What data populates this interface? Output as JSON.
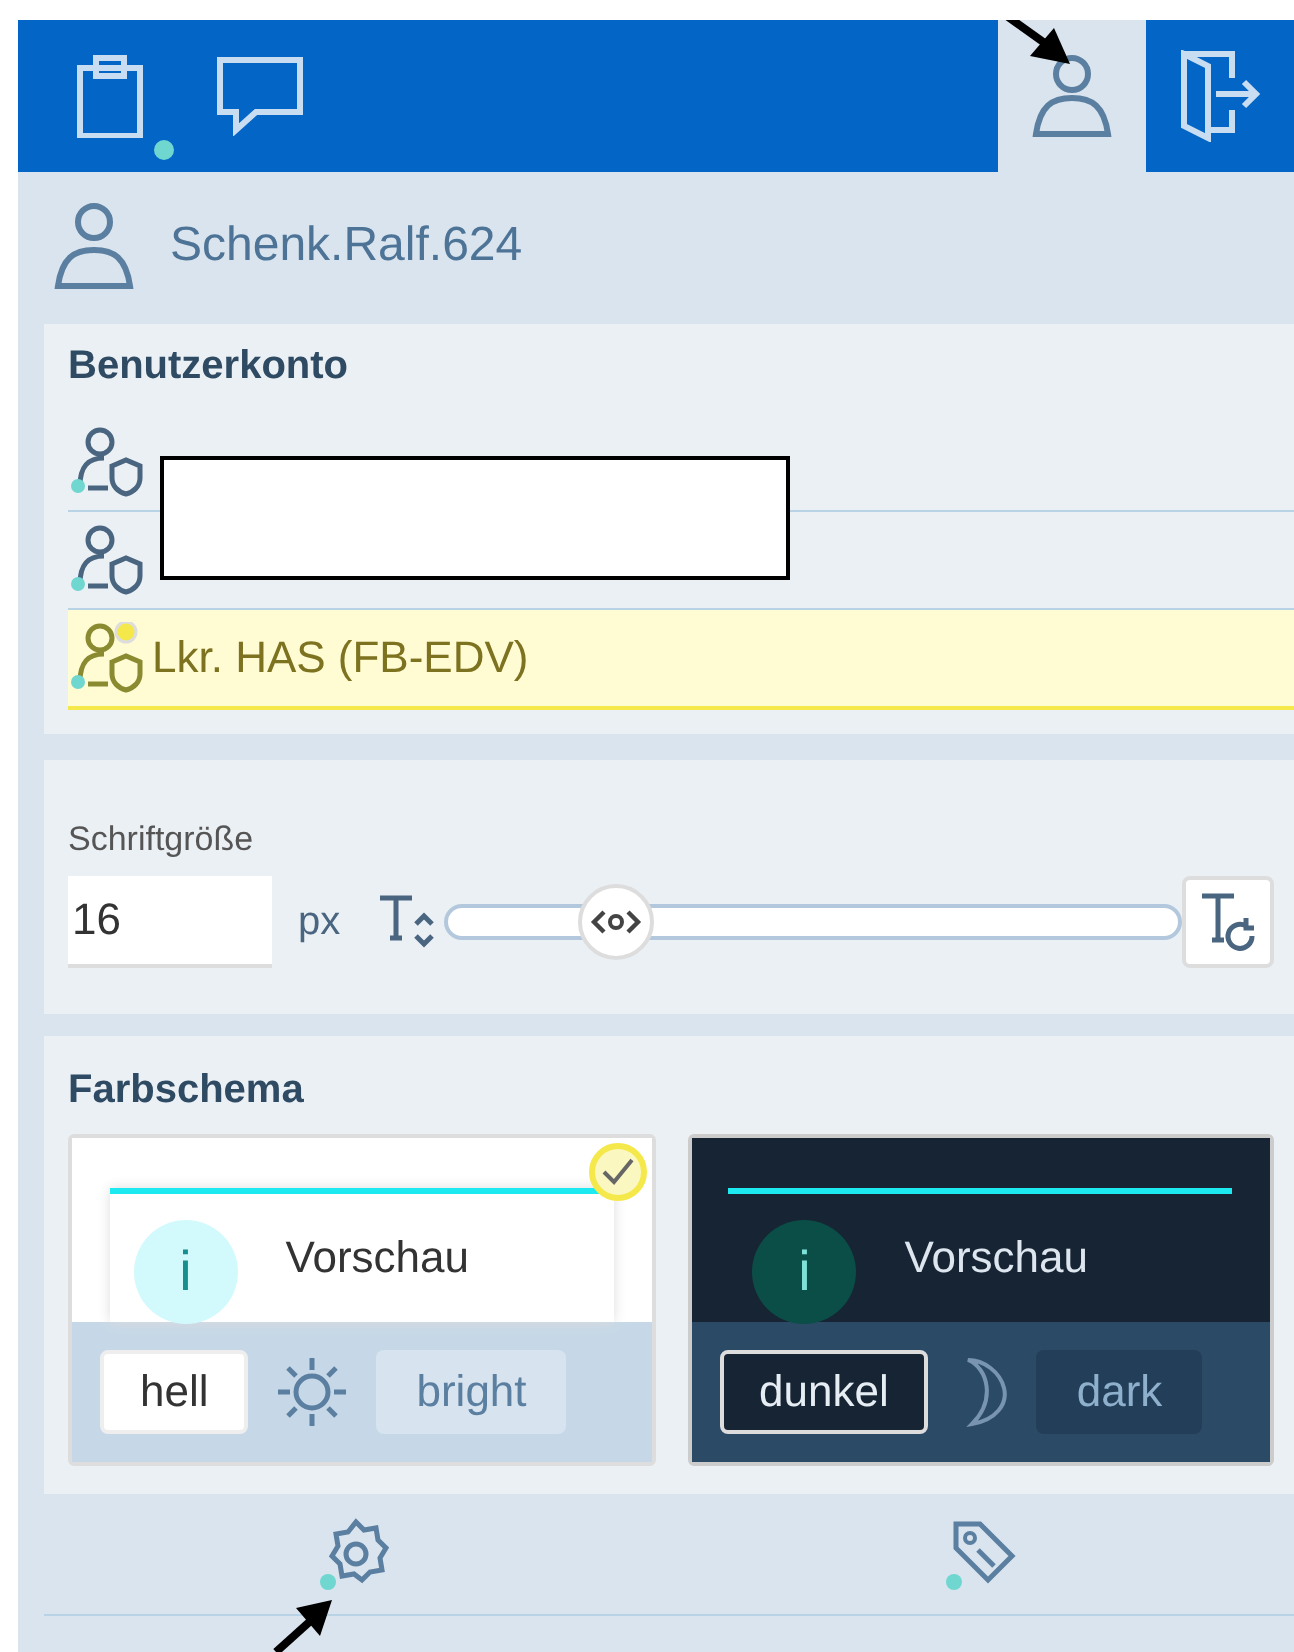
{
  "header": {
    "tabs": [
      {
        "kind": "clipboard",
        "selected": false,
        "badge": true
      },
      {
        "kind": "chat",
        "selected": false
      },
      {
        "kind": "user",
        "selected": true
      },
      {
        "kind": "logout",
        "selected": false
      }
    ]
  },
  "user": {
    "name": "Schenk.Ralf.624"
  },
  "account": {
    "title": "Benutzerkonto",
    "items": [
      {
        "selected": false
      },
      {
        "selected": false
      },
      {
        "label": "Lkr. HAS (FB-EDV)",
        "selected": true
      }
    ]
  },
  "font_size": {
    "label": "Schriftgröße",
    "value": "16",
    "unit": "px",
    "level": 0.23
  },
  "color_scheme": {
    "title": "Farbschema",
    "options": [
      {
        "kind": "light",
        "glyph": "i",
        "preview": "Vorschau",
        "name": "hell",
        "alt": "bright",
        "selected": true
      },
      {
        "kind": "dark",
        "glyph": "i",
        "preview": "Vorschau",
        "name": "dunkel",
        "alt": "dark",
        "selected": false
      }
    ]
  },
  "bottom_tabs": [
    {
      "kind": "settings",
      "badge": true
    },
    {
      "kind": "tag",
      "badge": true
    }
  ]
}
